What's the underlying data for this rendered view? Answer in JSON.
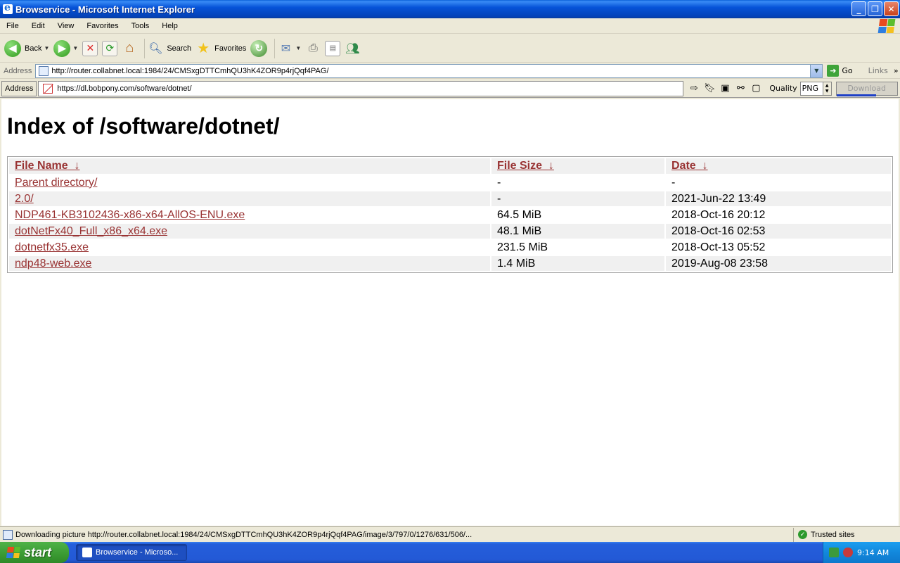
{
  "window": {
    "title": "Browservice - Microsoft Internet Explorer"
  },
  "menu": [
    "File",
    "Edit",
    "View",
    "Favorites",
    "Tools",
    "Help"
  ],
  "toolbar": {
    "back_label": "Back",
    "search_label": "Search",
    "favorites_label": "Favorites"
  },
  "address_bar": {
    "label": "Address",
    "url": "http://router.collabnet.local:1984/24/CMSxgDTTCmhQU3hK4ZOR9p4rjQqf4PAG/",
    "go_label": "Go",
    "links_label": "Links"
  },
  "inner_toolbar": {
    "address_label": "Address",
    "url": "https://dl.bobpony.com/software/dotnet/",
    "quality_label": "Quality",
    "quality_value": "PNG",
    "download_label": "Download",
    "download_progress_percent": 65
  },
  "page": {
    "heading": "Index of /software/dotnet/",
    "columns": {
      "name": "File Name",
      "size": "File Size",
      "date": "Date",
      "sort_arrow": "↓"
    },
    "rows": [
      {
        "name": "Parent directory/",
        "size": "-",
        "date": "-"
      },
      {
        "name": "2.0/",
        "size": "-",
        "date": "2021-Jun-22 13:49"
      },
      {
        "name": "NDP461-KB3102436-x86-x64-AllOS-ENU.exe",
        "size": "64.5 MiB",
        "date": "2018-Oct-16 20:12"
      },
      {
        "name": "dotNetFx40_Full_x86_x64.exe",
        "size": "48.1 MiB",
        "date": "2018-Oct-16 02:53"
      },
      {
        "name": "dotnetfx35.exe",
        "size": "231.5 MiB",
        "date": "2018-Oct-13 05:52"
      },
      {
        "name": "ndp48-web.exe",
        "size": "1.4 MiB",
        "date": "2019-Aug-08 23:58"
      }
    ],
    "link_color": "#993333"
  },
  "status_bar": {
    "text": "Downloading picture http://router.collabnet.local:1984/24/CMSxgDTTCmhQU3hK4ZOR9p4rjQqf4PAG/image/3/797/0/1276/631/506/...",
    "zone": "Trusted sites"
  },
  "taskbar": {
    "start_label": "start",
    "task_label": "Browservice - Microso...",
    "clock": "9:14 AM"
  }
}
